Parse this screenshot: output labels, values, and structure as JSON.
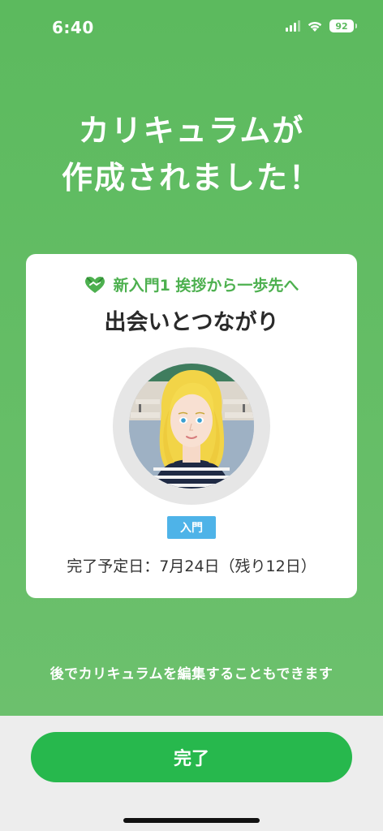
{
  "status_bar": {
    "time": "6:40",
    "battery": "92"
  },
  "headline": {
    "line1": "カリキュラムが",
    "line2": "作成されました！"
  },
  "card": {
    "course_label": "新入門1 挨拶から一歩先へ",
    "course_title": "出会いとつながり",
    "level_badge": "入門",
    "due_date": "完了予定日：7月24日（残り12日）",
    "icon": "handshake-heart-icon"
  },
  "edit_note": "後でカリキュラムを編集することもできます",
  "done_button": {
    "label": "完了"
  },
  "colors": {
    "background_green": "#5cba5e",
    "accent_green": "#4db04f",
    "button_green": "#27b84d",
    "badge_blue": "#4eb3e8"
  }
}
